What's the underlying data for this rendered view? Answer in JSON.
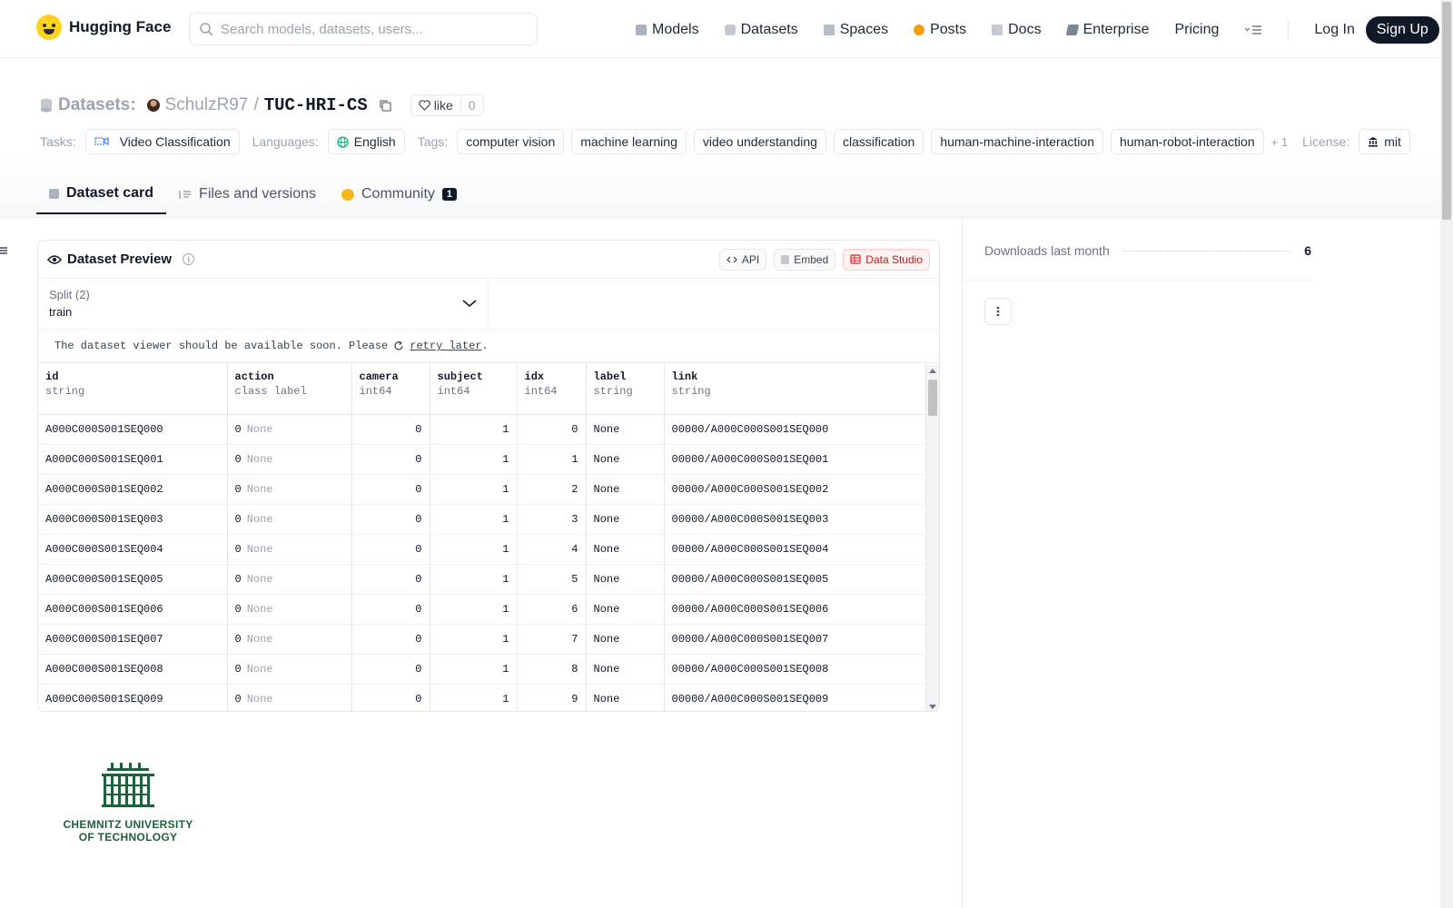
{
  "header": {
    "logo_text": "Hugging Face",
    "search_placeholder": "Search models, datasets, users...",
    "nav": [
      {
        "label": "Models",
        "icon": "cube-icon",
        "color": "#9ca3af"
      },
      {
        "label": "Datasets",
        "icon": "database-icon",
        "color": "#9ca3af"
      },
      {
        "label": "Spaces",
        "icon": "grid-icon",
        "color": "#9ca3af"
      },
      {
        "label": "Posts",
        "icon": "chat-icon",
        "color": "#f59e0b"
      },
      {
        "label": "Docs",
        "icon": "book-icon",
        "color": "#9ca3af"
      },
      {
        "label": "Enterprise",
        "icon": "enterprise-icon",
        "color": "#6b7280"
      },
      {
        "label": "Pricing"
      }
    ],
    "login": "Log In",
    "signup": "Sign Up"
  },
  "dataset": {
    "section": "Datasets:",
    "owner": "SchulzR97",
    "separator": "/",
    "name": "TUC-HRI-CS",
    "like_label": "like",
    "like_count": "0",
    "tasks_label": "Tasks:",
    "task": "Video Classification",
    "languages_label": "Languages:",
    "language": "English",
    "tags_label": "Tags:",
    "tags": [
      "computer vision",
      "machine learning",
      "video understanding",
      "classification",
      "human-machine-interaction",
      "human-robot-interaction"
    ],
    "more_tags": "+ 1",
    "license_label": "License:",
    "license": "mit"
  },
  "tabs": [
    {
      "label": "Dataset card",
      "icon": "cube-icon"
    },
    {
      "label": "Files and versions",
      "icon": "files-icon"
    },
    {
      "label": "Community",
      "icon": "hug-icon",
      "badge": "1"
    }
  ],
  "preview": {
    "title": "Dataset Preview",
    "btn_api": "API",
    "btn_embed": "Embed",
    "btn_studio": "Data Studio",
    "split_label": "Split (2)",
    "split_value": "train",
    "notice_text": "The dataset viewer should be available soon. Please",
    "notice_link": "retry later",
    "notice_end": ".",
    "columns": [
      {
        "name": "id",
        "type": "string"
      },
      {
        "name": "action",
        "type": "class label"
      },
      {
        "name": "camera",
        "type": "int64"
      },
      {
        "name": "subject",
        "type": "int64"
      },
      {
        "name": "idx",
        "type": "int64"
      },
      {
        "name": "label",
        "type": "string"
      },
      {
        "name": "link",
        "type": "string"
      }
    ],
    "rows": [
      [
        "A000C000S001SEQ000",
        "0",
        "None",
        "0",
        "1",
        "0",
        "None",
        "00000/A000C000S001SEQ000"
      ],
      [
        "A000C000S001SEQ001",
        "0",
        "None",
        "0",
        "1",
        "1",
        "None",
        "00000/A000C000S001SEQ001"
      ],
      [
        "A000C000S001SEQ002",
        "0",
        "None",
        "0",
        "1",
        "2",
        "None",
        "00000/A000C000S001SEQ002"
      ],
      [
        "A000C000S001SEQ003",
        "0",
        "None",
        "0",
        "1",
        "3",
        "None",
        "00000/A000C000S001SEQ003"
      ],
      [
        "A000C000S001SEQ004",
        "0",
        "None",
        "0",
        "1",
        "4",
        "None",
        "00000/A000C000S001SEQ004"
      ],
      [
        "A000C000S001SEQ005",
        "0",
        "None",
        "0",
        "1",
        "5",
        "None",
        "00000/A000C000S001SEQ005"
      ],
      [
        "A000C000S001SEQ006",
        "0",
        "None",
        "0",
        "1",
        "6",
        "None",
        "00000/A000C000S001SEQ006"
      ],
      [
        "A000C000S001SEQ007",
        "0",
        "None",
        "0",
        "1",
        "7",
        "None",
        "00000/A000C000S001SEQ007"
      ],
      [
        "A000C000S001SEQ008",
        "0",
        "None",
        "0",
        "1",
        "8",
        "None",
        "00000/A000C000S001SEQ008"
      ],
      [
        "A000C000S001SEQ009",
        "0",
        "None",
        "0",
        "1",
        "9",
        "None",
        "00000/A000C000S001SEQ009"
      ]
    ]
  },
  "university": {
    "line1": "CHEMNITZ UNIVERSITY",
    "line2": "OF TECHNOLOGY",
    "color": "#1f5f3a"
  },
  "sidebar": {
    "downloads_label": "Downloads last month",
    "downloads_value": "6"
  }
}
